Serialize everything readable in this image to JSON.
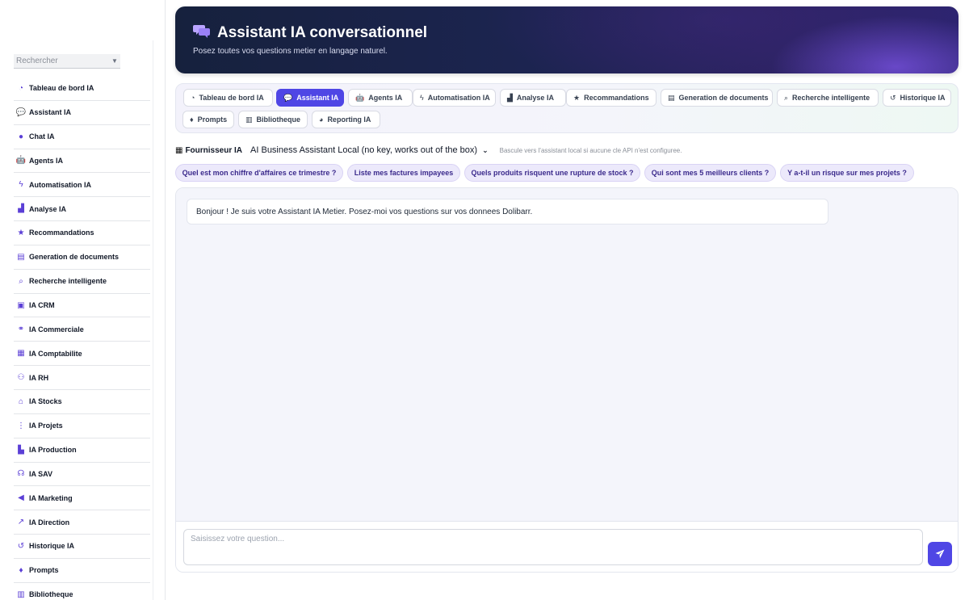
{
  "sidebar": {
    "search_placeholder": "Rechercher",
    "items": [
      {
        "label": "Tableau de bord IA",
        "icon": "gauge-icon"
      },
      {
        "label": "Assistant IA",
        "icon": "chat-bubbles-icon"
      },
      {
        "label": "Chat IA",
        "icon": "chat-bubble-icon"
      },
      {
        "label": "Agents IA",
        "icon": "robot-icon"
      },
      {
        "label": "Automatisation IA",
        "icon": "bolt-icon"
      },
      {
        "label": "Analyse IA",
        "icon": "bar-chart-icon"
      },
      {
        "label": "Recommandations",
        "icon": "star-icon"
      },
      {
        "label": "Generation de documents",
        "icon": "document-icon"
      },
      {
        "label": "Recherche intelligente",
        "icon": "search-icon"
      },
      {
        "label": "IA CRM",
        "icon": "address-book-icon"
      },
      {
        "label": "IA Commerciale",
        "icon": "handshake-icon"
      },
      {
        "label": "IA Comptabilite",
        "icon": "calculator-icon"
      },
      {
        "label": "IA RH",
        "icon": "users-icon"
      },
      {
        "label": "IA Stocks",
        "icon": "warehouse-icon"
      },
      {
        "label": "IA Projets",
        "icon": "project-diagram-icon"
      },
      {
        "label": "IA Production",
        "icon": "industry-icon"
      },
      {
        "label": "IA SAV",
        "icon": "headset-icon"
      },
      {
        "label": "IA Marketing",
        "icon": "megaphone-icon"
      },
      {
        "label": "IA Direction",
        "icon": "line-chart-icon"
      },
      {
        "label": "Historique IA",
        "icon": "history-icon"
      },
      {
        "label": "Prompts",
        "icon": "lightbulb-icon"
      },
      {
        "label": "Bibliotheque",
        "icon": "book-icon"
      }
    ]
  },
  "header": {
    "title": "Assistant IA conversationnel",
    "subtitle": "Posez toutes vos questions metier en langage naturel."
  },
  "tabs": [
    {
      "label": "Tableau de bord IA",
      "icon": "gauge-icon"
    },
    {
      "label": "Assistant IA",
      "icon": "chat-bubbles-icon",
      "active": true
    },
    {
      "label": "Agents IA",
      "icon": "robot-icon"
    },
    {
      "label": "Automatisation IA",
      "icon": "bolt-icon"
    },
    {
      "label": "Analyse IA",
      "icon": "bar-chart-icon"
    },
    {
      "label": "Recommandations",
      "icon": "star-icon"
    },
    {
      "label": "Generation de documents",
      "icon": "document-icon"
    },
    {
      "label": "Recherche intelligente",
      "icon": "search-icon"
    },
    {
      "label": "Historique IA",
      "icon": "history-icon"
    },
    {
      "label": "Prompts",
      "icon": "lightbulb-icon"
    },
    {
      "label": "Bibliotheque",
      "icon": "book-icon"
    },
    {
      "label": "Reporting IA",
      "icon": "pie-chart-icon"
    }
  ],
  "provider": {
    "label": "Fournisseur IA",
    "selected": "AI Business Assistant Local (no key, works out of the box)",
    "hint": "Bascule vers l'assistant local si aucune cle API n'est configuree."
  },
  "suggestions": [
    "Quel est mon chiffre d'affaires ce trimestre ?",
    "Liste mes factures impayees",
    "Quels produits risquent une rupture de stock ?",
    "Qui sont mes 5 meilleurs clients ?",
    "Y a-t-il un risque sur mes projets ?"
  ],
  "chat": {
    "messages": [
      {
        "role": "assistant",
        "text": "Bonjour ! Je suis votre Assistant IA Metier. Posez-moi vos questions sur vos donnees Dolibarr."
      }
    ],
    "input_placeholder": "Saisissez votre question..."
  },
  "colors": {
    "accent": "#4f46e5",
    "chip_bg": "#ece9fb",
    "chip_text": "#3b2a8c",
    "icon_purple": "#5b3fd6",
    "banner_dark": "#1c2450"
  }
}
